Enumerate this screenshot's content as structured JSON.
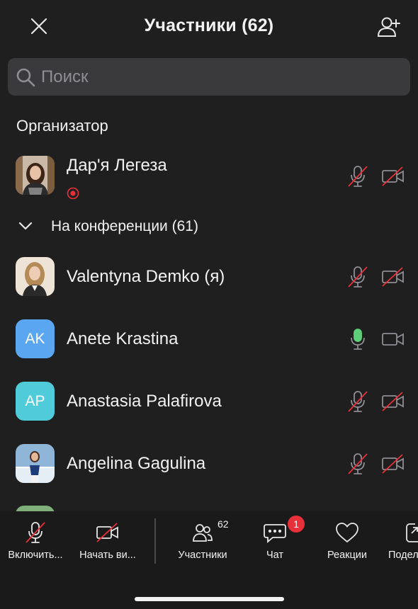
{
  "header": {
    "title": "Участники (62)"
  },
  "search": {
    "placeholder": "Поиск"
  },
  "organizer": {
    "section_label": "Организатор",
    "name": "Дар'я Легеза"
  },
  "conference": {
    "section_label": "На конференции (61)",
    "participants": [
      {
        "name": "Valentynа Demko (я)",
        "initials": "",
        "avatar_color": "#e9d8c4",
        "mic": "muted",
        "video": "off"
      },
      {
        "name": "Anete Krastina",
        "initials": "AK",
        "avatar_color": "#5aa6f0",
        "mic": "on",
        "video": "on"
      },
      {
        "name": "Anastasia Palafirova",
        "initials": "AP",
        "avatar_color": "#4fcbd9",
        "mic": "muted",
        "video": "off"
      },
      {
        "name": "Angelina Gagulina",
        "initials": "",
        "avatar_color": "#6f8fb0",
        "mic": "muted",
        "video": "off"
      }
    ]
  },
  "toolbar": {
    "unmute_label": "Включить...",
    "start_video_label": "Начать ви...",
    "participants_label": "Участники",
    "participants_count": "62",
    "chat_label": "Чат",
    "chat_badge": "1",
    "reactions_label": "Реакции",
    "share_label": "Подел"
  },
  "colors": {
    "background": "#1f1f1f",
    "muted_slash": "#e8303a",
    "mic_on": "#5fd07a",
    "badge": "#e8303a"
  }
}
